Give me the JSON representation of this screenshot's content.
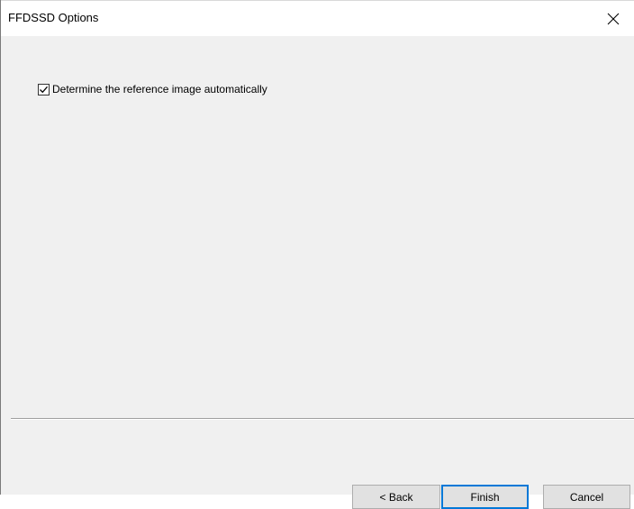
{
  "window": {
    "title": "FFDSSD Options"
  },
  "options": {
    "auto_reference": {
      "label": "Determine the reference image automatically",
      "checked": true
    }
  },
  "footer": {
    "back_label": "< Back",
    "finish_label": "Finish",
    "cancel_label": "Cancel"
  },
  "colors": {
    "accent": "#0078d7",
    "window_bg": "#f0f0f0",
    "titlebar_bg": "#ffffff"
  },
  "icons": {
    "close": "close-icon",
    "check": "checkmark-icon"
  }
}
